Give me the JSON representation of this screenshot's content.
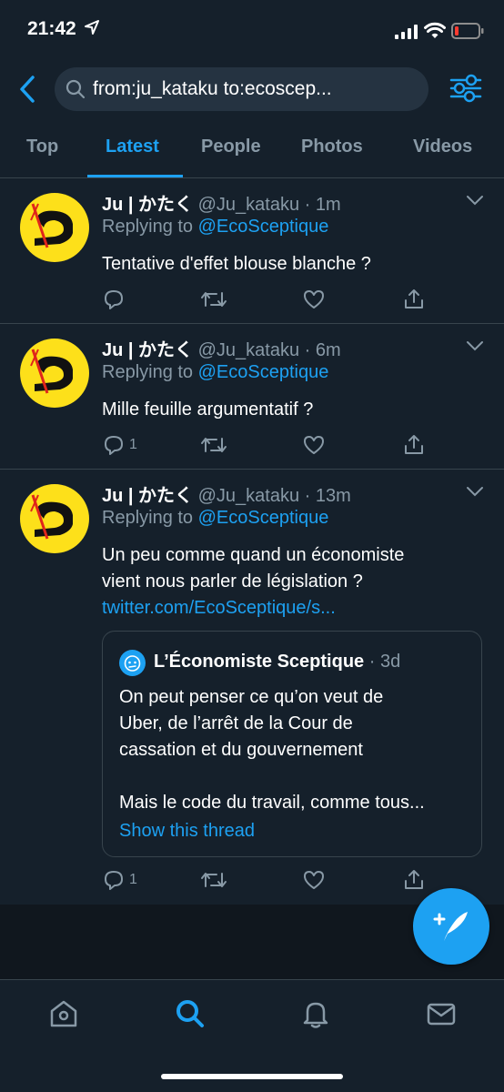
{
  "status_bar": {
    "time": "21:42"
  },
  "search": {
    "query": "from:ju_kataku to:ecoscep..."
  },
  "tabs": [
    {
      "label": "Top"
    },
    {
      "label": "Latest"
    },
    {
      "label": "People"
    },
    {
      "label": "Photos"
    },
    {
      "label": "Videos"
    }
  ],
  "active_tab": "Latest",
  "tweets": [
    {
      "name": "Ju | かたく",
      "handle": "@Ju_kataku",
      "time": "· 1m",
      "replying_prefix": "Replying to",
      "replying_to": "@EcoSceptique",
      "text": "Tentative d'effet blouse blanche ?",
      "reply_count": ""
    },
    {
      "name": "Ju | かたく",
      "handle": "@Ju_kataku",
      "time": "· 6m",
      "replying_prefix": "Replying to",
      "replying_to": "@EcoSceptique",
      "text": "Mille feuille argumentatif ?",
      "reply_count": "1"
    },
    {
      "name": "Ju | かたく",
      "handle": "@Ju_kataku",
      "time": "· 13m",
      "replying_prefix": "Replying to",
      "replying_to": "@EcoSceptique",
      "text_line1": "Un peu comme quand un économiste",
      "text_line2": "vient nous parler de législation ?",
      "link": "twitter.com/EcoSceptique/s...",
      "reply_count": "1",
      "quote": {
        "name": "L’Économiste Sceptique",
        "time": "· 3d",
        "line1": "On peut penser ce qu’on veut de",
        "line2": "Uber, de l’arrêt de la Cour de",
        "line3": "cassation et du gouvernement",
        "line4": "Mais le code du travail, comme tous...",
        "thread_link": "Show this thread"
      }
    }
  ],
  "colors": {
    "background": "#15202b",
    "accent": "#1da1f2",
    "secondary_text": "#8899a6",
    "divider": "#38444d",
    "avatar_yellow": "#fde01a"
  },
  "icons": {
    "back": "chevron-left-icon",
    "search": "search-icon",
    "filter": "filter-sliders-icon",
    "reply": "reply-icon",
    "retweet": "retweet-icon",
    "like": "heart-icon",
    "share": "share-icon",
    "compose": "compose-tweet-icon",
    "home": "home-icon",
    "explore": "search-icon",
    "notifications": "bell-icon",
    "messages": "mail-icon"
  }
}
